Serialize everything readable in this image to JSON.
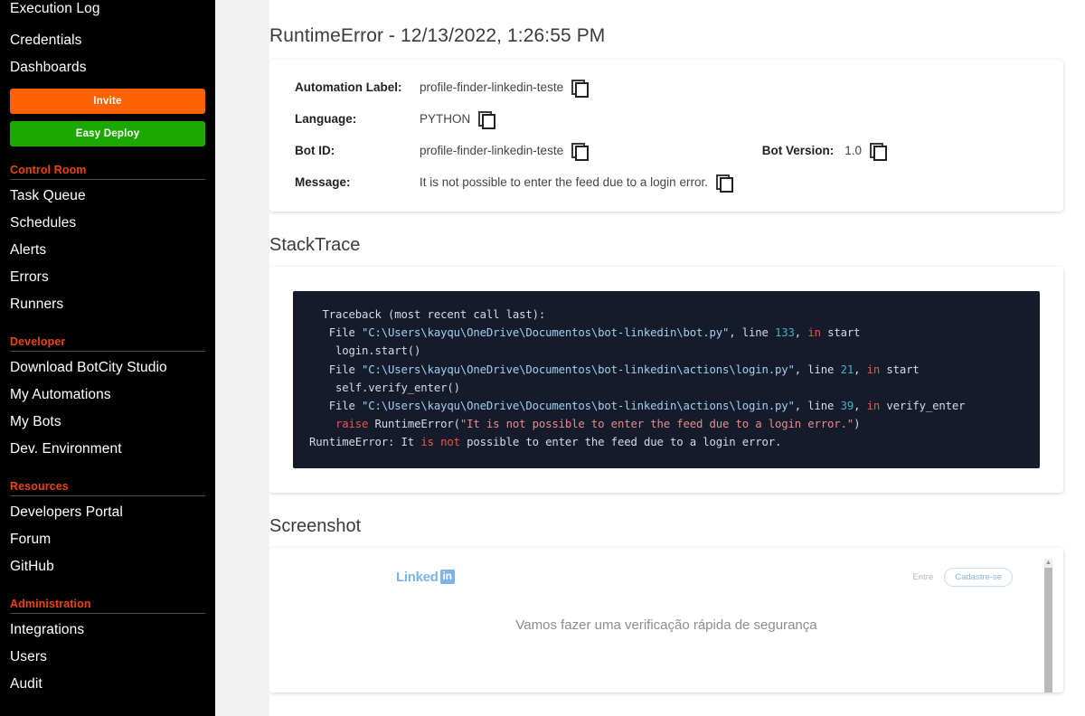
{
  "sidebar": {
    "top_items": [
      {
        "label": "Execution Log"
      },
      {
        "label": "Credentials"
      },
      {
        "label": "Dashboards"
      }
    ],
    "buttons": {
      "invite": "Invite",
      "easy_deploy": "Easy Deploy"
    },
    "sections": [
      {
        "title": "Control Room",
        "items": [
          "Task Queue",
          "Schedules",
          "Alerts",
          "Errors",
          "Runners"
        ]
      },
      {
        "title": "Developer",
        "items": [
          "Download BotCity Studio",
          "My Automations",
          "My Bots",
          "Dev. Environment"
        ]
      },
      {
        "title": "Resources",
        "items": [
          "Developers Portal",
          "Forum",
          "GitHub"
        ]
      },
      {
        "title": "Administration",
        "items": [
          "Integrations",
          "Users",
          "Audit"
        ]
      }
    ],
    "colors": {
      "background": "#000000",
      "section_header": "#e8450f",
      "invite_button": "#ff6200",
      "deploy_button": "#1ba800"
    }
  },
  "main": {
    "page_title": "RuntimeError - 12/13/2022, 1:26:55 PM",
    "info": {
      "automation_label_key": "Automation Label:",
      "automation_label_value": "profile-finder-linkedin-teste",
      "language_key": "Language:",
      "language_value": "PYTHON",
      "bot_id_key": "Bot ID:",
      "bot_id_value": "profile-finder-linkedin-teste",
      "bot_version_key": "Bot Version:",
      "bot_version_value": "1.0",
      "message_key": "Message:",
      "message_value": "It is not possible to enter the feed due to a login error."
    },
    "stacktrace": {
      "heading": "StackTrace",
      "lines": [
        "  Traceback (most recent call last):",
        "   File \"C:\\Users\\kayqu\\OneDrive\\Documentos\\bot-linkedin\\bot.py\", line 133, in start",
        "    login.start()",
        "   File \"C:\\Users\\kayqu\\OneDrive\\Documentos\\bot-linkedin\\actions\\login.py\", line 21, in start",
        "    self.verify_enter()",
        "   File \"C:\\Users\\kayqu\\OneDrive\\Documentos\\bot-linkedin\\actions\\login.py\", line 39, in verify_enter",
        "    raise RuntimeError(\"It is not possible to enter the feed due to a login error.\")",
        "RuntimeError: It is not possible to enter the feed due to a login error."
      ]
    },
    "screenshot": {
      "heading": "Screenshot",
      "linkedin_logo": "Linked",
      "linkedin_badge": "in",
      "sign_in": "Entre",
      "join_now": "Cadastre-se",
      "headline": "Vamos fazer uma verificação rápida de segurança"
    }
  }
}
